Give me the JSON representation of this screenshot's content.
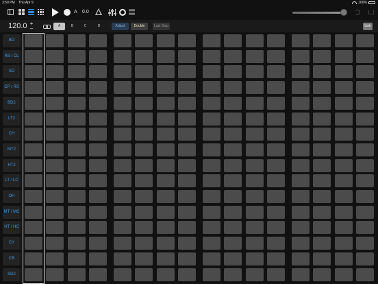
{
  "status": {
    "time": "3:59 PM",
    "date": "Thu Apr 9",
    "battery": "100%"
  },
  "toolbar": {
    "icons": [
      "sidebar-icon",
      "grid-icon",
      "list-icon",
      "sequencer-icon",
      "play-icon",
      "record-icon",
      "metronome-icon",
      "mixer-icon",
      "ring-icon",
      "lines-icon",
      "redo-icon",
      "share-icon"
    ],
    "pattern_letter": "A",
    "value": "0.0",
    "active_color": "#2f88e6"
  },
  "controls": {
    "tempo": "120.0",
    "plus": "+",
    "minus": "−",
    "patterns": [
      "A",
      "B",
      "C",
      "D"
    ],
    "selected_pattern": "A",
    "adjust_label": "Adjust",
    "double_label": "Double",
    "last_step_label": "Last Step",
    "link_label": "Link"
  },
  "tracks": [
    "BD",
    "RS / CL",
    "SD",
    "CP / RS",
    "BD2",
    "LT2",
    "CH",
    "MT2",
    "HT2",
    "LT / LC",
    "OH",
    "MT / MC",
    "HT / HC",
    "CY",
    "CB",
    "SD2"
  ],
  "track_color": "#3f9be8",
  "steps_per_track": 16,
  "playhead_step": 1
}
